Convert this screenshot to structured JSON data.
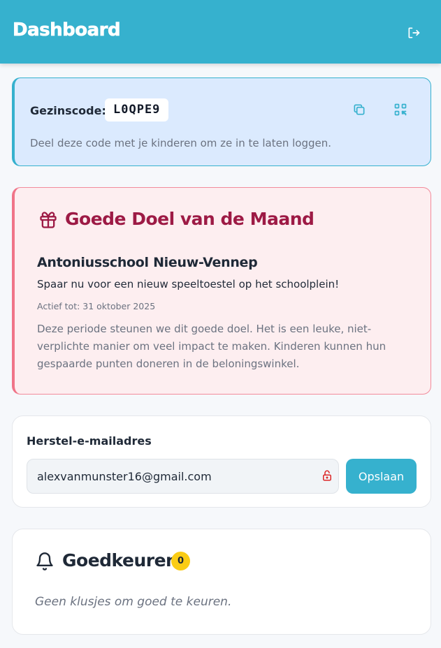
{
  "header": {
    "title": "Dashboard",
    "logout_icon": "logout-icon"
  },
  "family_code": {
    "label": "Gezinscode:",
    "code": "L0QPE9",
    "copy_icon": "copy-icon",
    "qr_icon": "qr-code-icon",
    "hint": "Deel deze code met je kinderen om ze in te laten loggen."
  },
  "charity": {
    "icon": "gift-icon",
    "title": "Goede Doel van de Maand",
    "name": "Antoniusschool Nieuw-Vennep",
    "subtitle": "Spaar nu voor een nieuw speeltoestel op het schoolplein!",
    "active_until": "Actief tot: 31 oktober 2025",
    "description": "Deze periode steunen we dit goede doel. Het is een leuke, niet-verplichte manier om veel impact te maken. Kinderen kunnen hun gespaarde punten doneren in de beloningswinkel."
  },
  "recovery": {
    "label": "Herstel-e-mailadres",
    "email_value": "alexvanmunster16@gmail.com",
    "lock_icon": "lock-open-icon",
    "save_label": "Opslaan"
  },
  "approvals": {
    "icon": "bell-icon",
    "title": "Goedkeuren",
    "count": "0",
    "empty": "Geen klusjes om goed te keuren."
  },
  "colors": {
    "primary": "#36b1ce",
    "charity_accent": "#9d1a45",
    "charity_border": "#f07488",
    "badge": "#facc15",
    "lock": "#dc2626"
  }
}
